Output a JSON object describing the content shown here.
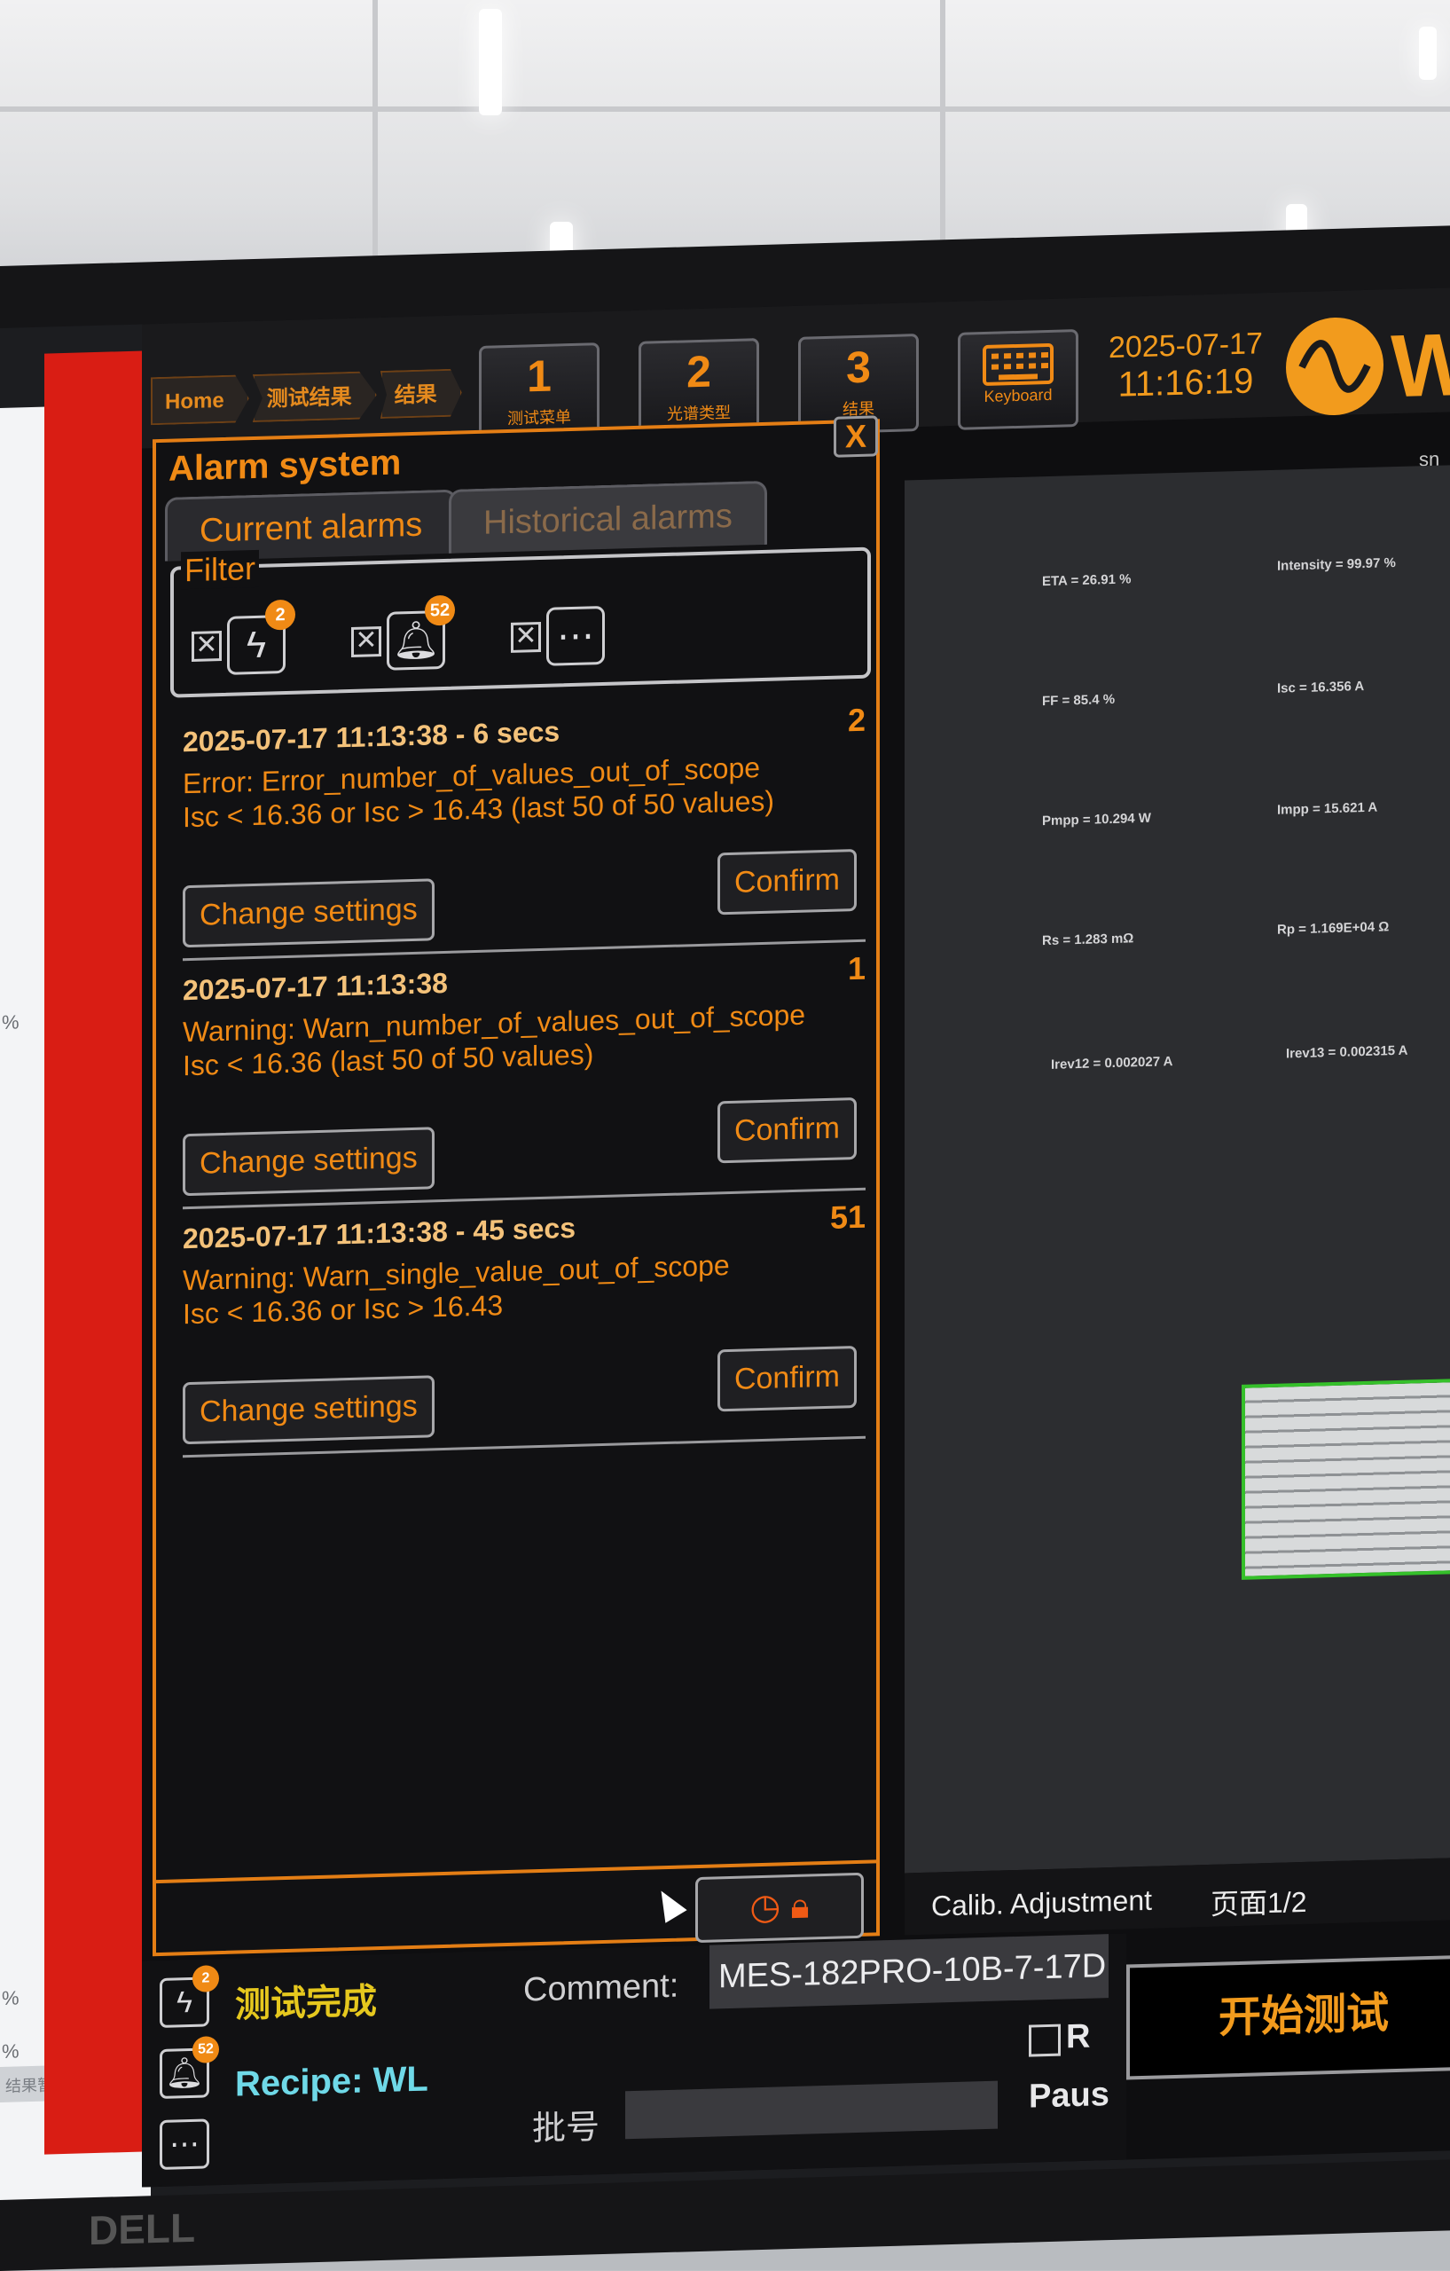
{
  "breadcrumb": [
    "Home",
    "测试结果",
    "结果"
  ],
  "nav": [
    {
      "num": "1",
      "label": "测试菜单"
    },
    {
      "num": "2",
      "label": "光谱类型"
    },
    {
      "num": "3",
      "label": "结果"
    }
  ],
  "keyboard_label": "Keyboard",
  "clock": {
    "date": "2025-07-17",
    "time": "11:16:19"
  },
  "brand_partial": "W",
  "sn_partial": "sn",
  "alarm": {
    "title": "Alarm system",
    "close": "X",
    "tabs": {
      "current": "Current alarms",
      "historical": "Historical alarms"
    },
    "filter_label": "Filter",
    "filters": [
      {
        "icon": "lightning-icon",
        "badge": "2"
      },
      {
        "icon": "bell-icon",
        "badge": "52"
      },
      {
        "icon": "chat-icon",
        "badge": ""
      }
    ],
    "entries": [
      {
        "timestamp": "2025-07-17 11:13:38 - 6 secs",
        "count": "2",
        "line1": "Error: Error_number_of_values_out_of_scope",
        "line2": "Isc < 16.36 or Isc > 16.43 (last 50 of 50 values)",
        "change": "Change settings",
        "confirm": "Confirm"
      },
      {
        "timestamp": "2025-07-17 11:13:38",
        "count": "1",
        "line1": "Warning: Warn_number_of_values_out_of_scope",
        "line2": "Isc < 16.36 (last 50 of 50 values)",
        "change": "Change settings",
        "confirm": "Confirm"
      },
      {
        "timestamp": "2025-07-17 11:13:38 - 45 secs",
        "count": "51",
        "line1": "Warning: Warn_single_value_out_of_scope",
        "line2": "Isc < 16.36 or Isc > 16.43",
        "change": "Change settings",
        "confirm": "Confirm"
      }
    ]
  },
  "measurements": [
    "ETA = 26.91 %",
    "Intensity = 99.97 %",
    "FF = 85.4 %",
    "Isc = 16.356 A",
    "Pmpp = 10.294 W",
    "Impp = 15.621 A",
    "Rs = 1.283 mΩ",
    "Rp = 1.169E+04 Ω",
    "Irev12 = 0.002027 A",
    "Irev13 = 0.002315 A"
  ],
  "bottom_right": {
    "calib": "Calib. Adjustment",
    "page": "页面1/2"
  },
  "start_button": "开始测试",
  "status": {
    "done": "测试完成",
    "recipe": "Recipe: WL",
    "comment_label": "Comment:",
    "comment_value": "MES-182PRO-10B-7-17D",
    "batch_label": "批号",
    "r_label": "R",
    "pause_label": "Paus",
    "badges": {
      "lightning": "2",
      "bell": "52"
    }
  },
  "left_app": {
    "pct": [
      "%",
      "%",
      "%",
      "%"
    ],
    "footer": "结果暂存"
  },
  "bezel_text": "DELL"
}
